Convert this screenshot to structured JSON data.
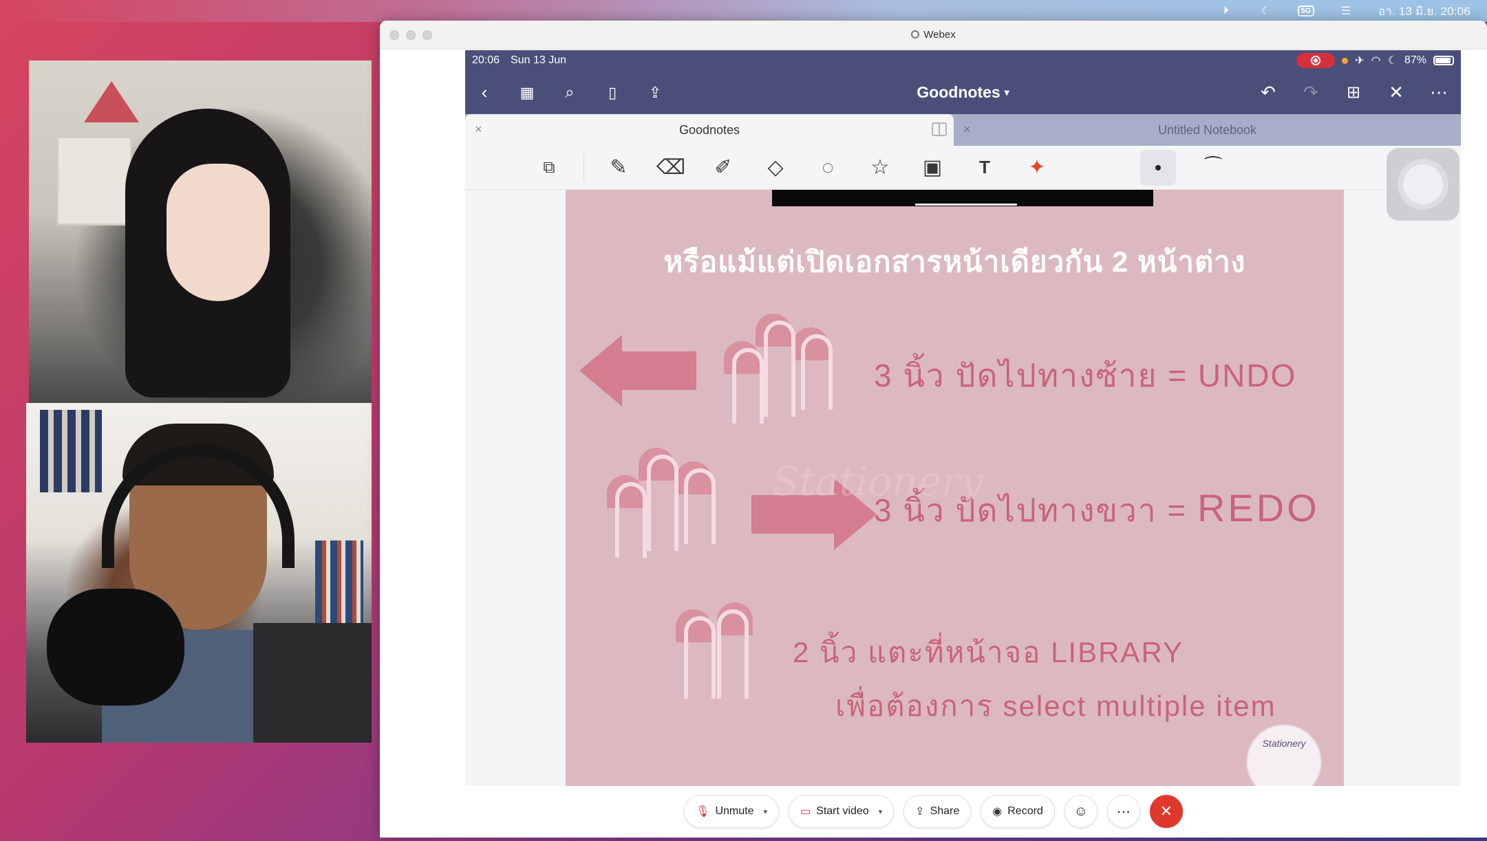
{
  "menubar": {
    "clock": "อา. 13 มิ.ย. 20:06",
    "battery_badge": "5G"
  },
  "window": {
    "title": "Webex"
  },
  "ipad": {
    "status_time": "20:06",
    "status_date": "Sun 13 Jun",
    "battery_percent": "87%",
    "nav_title": "Goodnotes",
    "tabs": [
      {
        "label": "Goodnotes",
        "active": true
      },
      {
        "label": "Untitled Notebook",
        "active": false
      }
    ]
  },
  "page": {
    "heading": "หรือแม้แต่เปิดเอกสารหน้าเดียวกัน 2 หน้าต่าง",
    "line_undo_prefix": "3 นิ้ว ปัดไปทางซ้าย = ",
    "line_undo_action": "UNDO",
    "line_redo_prefix": "3 นิ้ว ปัดไปทางขวา = ",
    "line_redo_action": "REDO",
    "line_library_1": "2 นิ้ว แตะที่หน้าจอ LIBRARY",
    "line_library_2": "เพื่อต้องการ select multiple item",
    "logo_text": "Stationery"
  },
  "controls": {
    "unmute": "Unmute",
    "start_video": "Start video",
    "share": "Share",
    "record": "Record"
  },
  "colors": {
    "ipad_bar": "#4a4f7a",
    "page_pink": "#dcb9c0",
    "gesture_text": "#c9637b",
    "end_call": "#e0392b"
  }
}
